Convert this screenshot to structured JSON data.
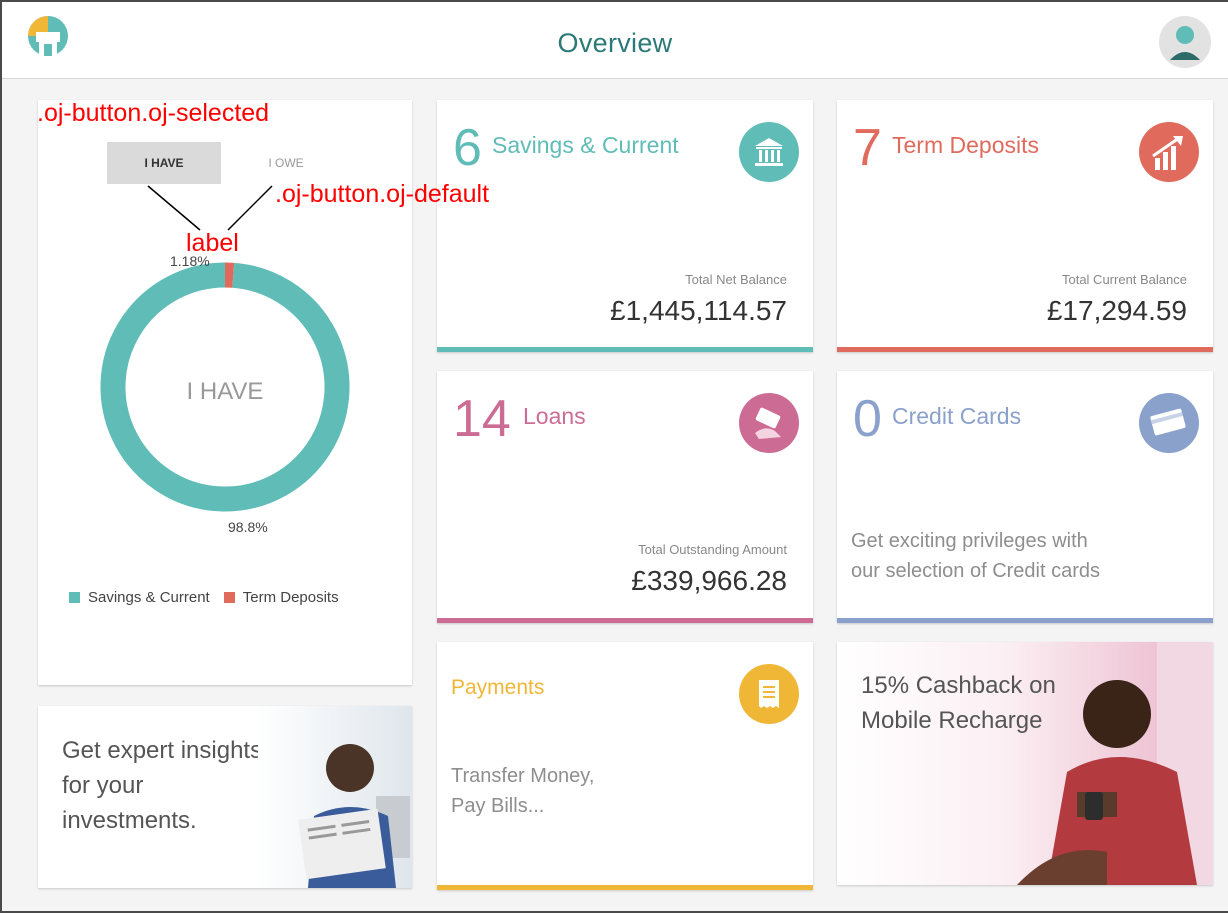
{
  "header": {
    "title": "Overview",
    "logo_icon": "bank-logo-icon",
    "avatar_icon": "user-avatar-icon"
  },
  "summary": {
    "toggle": {
      "have_label": "I HAVE",
      "owe_label": "I OWE",
      "selected": "I HAVE"
    },
    "donut": {
      "center_label": "I HAVE",
      "small_pct_label": "1.18%",
      "big_pct_label": "98.8%",
      "segments": [
        {
          "name": "Savings & Current",
          "value": 98.8,
          "color": "#5fbcb7"
        },
        {
          "name": "Term Deposits",
          "value": 1.18,
          "color": "#e06b5d"
        }
      ]
    },
    "legend": [
      {
        "label": "Savings & Current",
        "color": "#5fbcb7"
      },
      {
        "label": "Term Deposits",
        "color": "#e06b5d"
      }
    ]
  },
  "cards": {
    "savings": {
      "count": "6",
      "label": "Savings & Current",
      "sub": "Total Net Balance",
      "amount": "£1,445,114.57",
      "icon": "bank-icon",
      "color": "#5fbcb7"
    },
    "term": {
      "count": "7",
      "label": "Term Deposits",
      "sub": "Total Current Balance",
      "amount": "£17,294.59",
      "icon": "growth-chart-icon",
      "color": "#e06b5d"
    },
    "loans": {
      "count": "14",
      "label": "Loans",
      "sub": "Total Outstanding Amount",
      "amount": "£339,966.28",
      "icon": "money-hand-icon",
      "color": "#cc6c94"
    },
    "credit": {
      "count": "0",
      "label": "Credit Cards",
      "desc_line1": "Get exciting privileges with",
      "desc_line2": "our selection of Credit cards",
      "icon": "credit-card-icon",
      "color": "#8aa1cc"
    },
    "payments": {
      "label": "Payments",
      "desc_line1": "Transfer Money,",
      "desc_line2": "Pay Bills...",
      "icon": "receipt-icon",
      "color": "#f0b736"
    }
  },
  "promos": {
    "insights": {
      "line1": "Get expert insights",
      "line2": "for your",
      "line3": "investments."
    },
    "cashback": {
      "line1": "15% Cashback on",
      "line2": "Mobile Recharge"
    }
  },
  "annotations": {
    "selected": ".oj-button.oj-selected",
    "default": ".oj-button.oj-default",
    "label": "label"
  }
}
